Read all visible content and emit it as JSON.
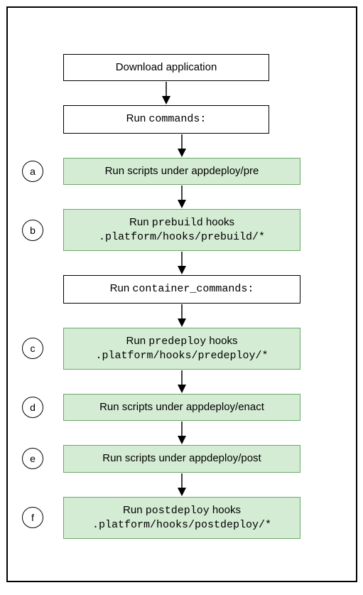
{
  "steps": [
    {
      "marker": "",
      "text": "Download application",
      "code": "",
      "path": "",
      "green": false,
      "wide": false
    },
    {
      "marker": "",
      "text": "Run ",
      "code": "commands:",
      "path": "",
      "green": false,
      "wide": false
    },
    {
      "marker": "a",
      "text": "Run scripts under appdeploy/pre",
      "code": "",
      "path": "",
      "green": true,
      "wide": true
    },
    {
      "marker": "b",
      "text": "Run ",
      "code": "prebuild",
      "text2": " hooks",
      "path": ".platform/hooks/prebuild/*",
      "green": true,
      "wide": true
    },
    {
      "marker": "",
      "text": "Run ",
      "code": "container_commands:",
      "path": "",
      "green": false,
      "wide": true
    },
    {
      "marker": "c",
      "text": "Run ",
      "code": "predeploy",
      "text2": " hooks",
      "path": ".platform/hooks/predeploy/*",
      "green": true,
      "wide": true
    },
    {
      "marker": "d",
      "text": "Run scripts under appdeploy/enact",
      "code": "",
      "path": "",
      "green": true,
      "wide": true
    },
    {
      "marker": "e",
      "text": "Run scripts under appdeploy/post",
      "code": "",
      "path": "",
      "green": true,
      "wide": true
    },
    {
      "marker": "f",
      "text": "Run ",
      "code": "postdeploy",
      "text2": " hooks",
      "path": ".platform/hooks/postdeploy/*",
      "green": true,
      "wide": true
    }
  ]
}
